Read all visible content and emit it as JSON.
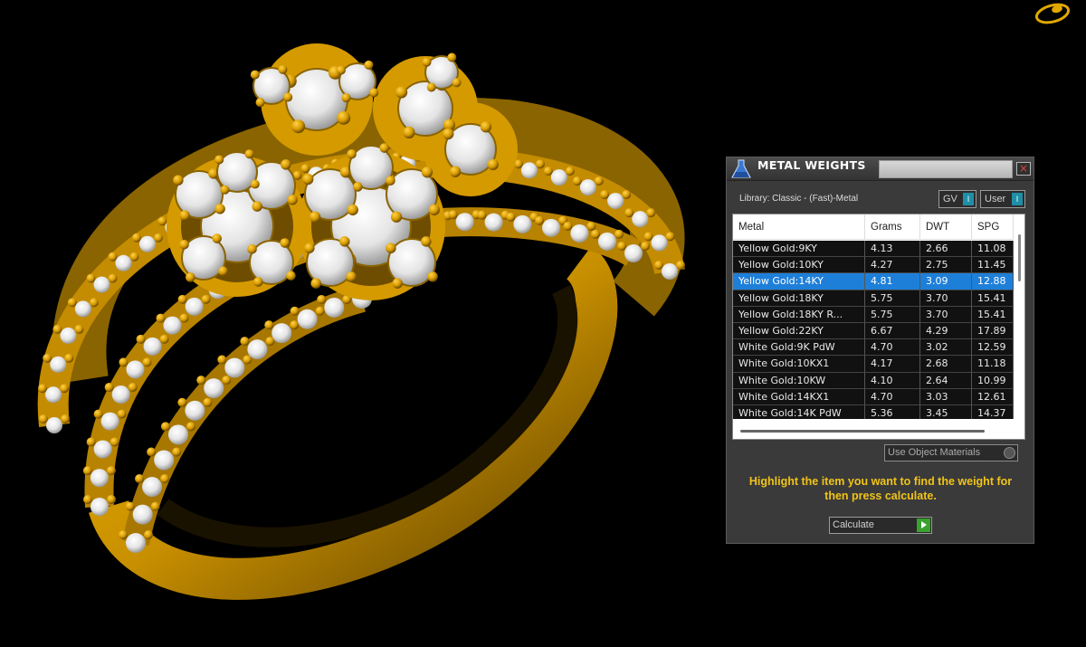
{
  "dialog": {
    "title": "METAL WEIGHTS",
    "close_glyph": "×",
    "library_label": "Library: Classic - (Fast)-Metal",
    "gv_label": "GV",
    "user_label": "User",
    "toggle_knob": "I",
    "columns": [
      "Metal",
      "Grams",
      "DWT",
      "SPG"
    ],
    "rows": [
      [
        "Yellow Gold:9KY",
        "4.13",
        "2.66",
        "11.08"
      ],
      [
        "Yellow Gold:10KY",
        "4.27",
        "2.75",
        "11.45"
      ],
      [
        "Yellow Gold:14KY",
        "4.81",
        "3.09",
        "12.88"
      ],
      [
        "Yellow Gold:18KY",
        "5.75",
        "3.70",
        "15.41"
      ],
      [
        "Yellow Gold:18KY R...",
        "5.75",
        "3.70",
        "15.41"
      ],
      [
        "Yellow Gold:22KY",
        "6.67",
        "4.29",
        "17.89"
      ],
      [
        "White Gold:9K PdW",
        "4.70",
        "3.02",
        "12.59"
      ],
      [
        "White Gold:10KX1",
        "4.17",
        "2.68",
        "11.18"
      ],
      [
        "White Gold:10KW",
        "4.10",
        "2.64",
        "10.99"
      ],
      [
        "White Gold:14KX1",
        "4.70",
        "3.03",
        "12.61"
      ],
      [
        "White Gold:14K PdW",
        "5.36",
        "3.45",
        "14.37"
      ]
    ],
    "selected_row": 2,
    "use_object_materials": "Use Object Materials",
    "hint": "Highlight the item you want to find the weight for then press calculate.",
    "calculate_label": "Calculate"
  },
  "colors": {
    "gold": "#e1a800",
    "gold_dark": "#7a5800",
    "stone": "#f2f2f2",
    "hint": "#f0c419",
    "selection": "#1e7fd9"
  }
}
